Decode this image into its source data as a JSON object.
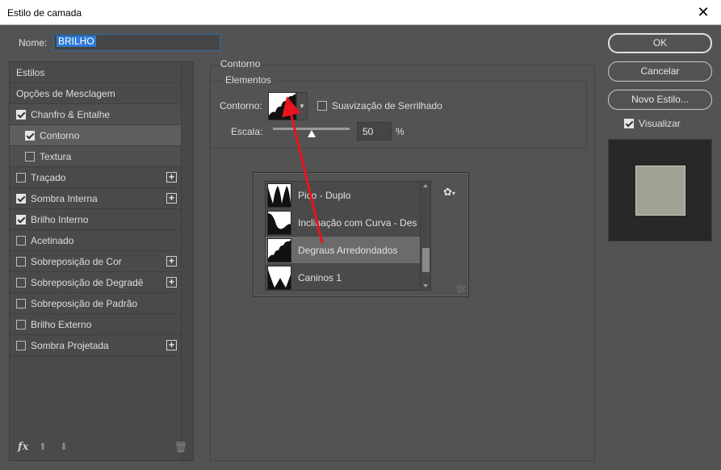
{
  "window": {
    "title": "Estilo de camada"
  },
  "name_field": {
    "label": "Nome:",
    "value": "BRILHO"
  },
  "styles_list": [
    {
      "label": "Estilos",
      "type": "header",
      "checkbox": false,
      "checked": false,
      "plus": false,
      "selected": false
    },
    {
      "label": "Opções de Mesclagem",
      "type": "header",
      "checkbox": false,
      "checked": false,
      "plus": false,
      "selected": false
    },
    {
      "label": "Chanfro & Entalhe",
      "type": "item",
      "checkbox": true,
      "checked": true,
      "plus": false,
      "selected": false,
      "hdr": true
    },
    {
      "label": "Contorno",
      "type": "child",
      "checkbox": true,
      "checked": true,
      "plus": false,
      "selected": true
    },
    {
      "label": "Textura",
      "type": "child",
      "checkbox": true,
      "checked": false,
      "plus": false,
      "selected": false,
      "hdr": true
    },
    {
      "label": "Traçado",
      "type": "item",
      "checkbox": true,
      "checked": false,
      "plus": true,
      "selected": false
    },
    {
      "label": "Sombra Interna",
      "type": "item",
      "checkbox": true,
      "checked": true,
      "plus": true,
      "selected": false
    },
    {
      "label": "Brilho Interno",
      "type": "item",
      "checkbox": true,
      "checked": true,
      "plus": false,
      "selected": false
    },
    {
      "label": "Acetinado",
      "type": "item",
      "checkbox": true,
      "checked": false,
      "plus": false,
      "selected": false
    },
    {
      "label": "Sobreposição de Cor",
      "type": "item",
      "checkbox": true,
      "checked": false,
      "plus": true,
      "selected": false
    },
    {
      "label": "Sobreposição de Degradê",
      "type": "item",
      "checkbox": true,
      "checked": false,
      "plus": true,
      "selected": false
    },
    {
      "label": "Sobreposição de Padrão",
      "type": "item",
      "checkbox": true,
      "checked": false,
      "plus": false,
      "selected": false
    },
    {
      "label": "Brilho Externo",
      "type": "item",
      "checkbox": true,
      "checked": false,
      "plus": false,
      "selected": false
    },
    {
      "label": "Sombra Projetada",
      "type": "item",
      "checkbox": true,
      "checked": false,
      "plus": true,
      "selected": false
    }
  ],
  "left_footer": {
    "fx": "fx"
  },
  "contorno_group": {
    "title": "Contorno",
    "subtitle": "Elementos",
    "contour_label": "Contorno:",
    "smooth_label": "Suavização de Serrilhado",
    "smooth_checked": false,
    "scale_label": "Escala:",
    "scale_value": "50",
    "scale_unit": "%",
    "scale_fraction": 0.5
  },
  "contour_picker": {
    "items": [
      {
        "label": "Pico - Duplo",
        "shape": "double-peak",
        "selected": false
      },
      {
        "label": "Inclinação com Curva - Des",
        "shape": "slope-curve",
        "selected": false
      },
      {
        "label": "Degraus Arredondados",
        "shape": "rounded-steps",
        "selected": true
      },
      {
        "label": "Caninos 1",
        "shape": "canines",
        "selected": false
      }
    ]
  },
  "buttons": {
    "ok": "OK",
    "cancel": "Cancelar",
    "new_style": "Novo Estilo..."
  },
  "preview": {
    "label": "Visualizar",
    "checked": true,
    "swatch_color": "#a2a294"
  },
  "annotation": {
    "arrow_color": "#e8141e"
  }
}
